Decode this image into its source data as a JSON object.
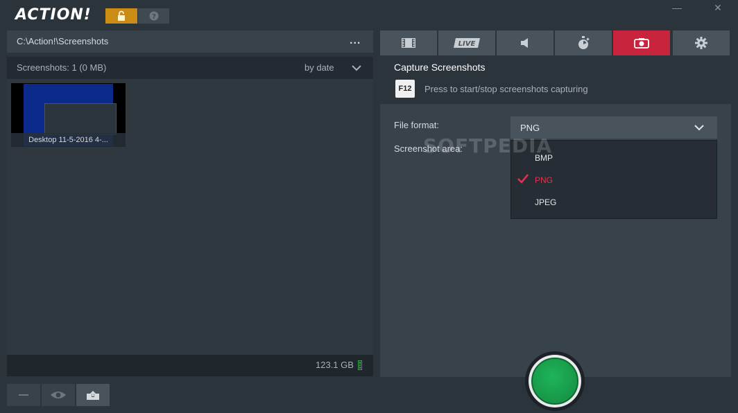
{
  "app": {
    "logo_text": "ACTION!",
    "window_controls": {
      "minimize": "—",
      "close": "✕"
    }
  },
  "header": {
    "lock_icon": "lock-icon",
    "help_icon": "question-icon"
  },
  "left_panel": {
    "path": "C:\\Action!\\Screenshots",
    "more_label": "...",
    "count_label": "Screenshots: 1 (0 MB)",
    "sort_label": "by date",
    "items": [
      {
        "caption": "Desktop 11-5-2016 4-..."
      }
    ],
    "disk_free": "123.1 GB"
  },
  "bottom_buttons": [
    {
      "icon": "minus-icon"
    },
    {
      "icon": "eye-icon"
    },
    {
      "icon": "export-icon"
    }
  ],
  "tabs": [
    {
      "icon": "film-icon"
    },
    {
      "icon": "live-icon",
      "label": "LIVE"
    },
    {
      "icon": "speaker-icon"
    },
    {
      "icon": "stopwatch-icon"
    },
    {
      "icon": "camera-icon",
      "active": true
    },
    {
      "icon": "gear-icon"
    }
  ],
  "capture": {
    "title": "Capture Screenshots",
    "hotkey": "F12",
    "hint": "Press to start/stop screenshots capturing"
  },
  "settings": {
    "file_format_label": "File format:",
    "file_format_value": "PNG",
    "screenshot_area_label": "Screenshot area:",
    "format_options": [
      {
        "label": "BMP",
        "selected": false
      },
      {
        "label": "PNG",
        "selected": true
      },
      {
        "label": "JPEG",
        "selected": false
      }
    ]
  },
  "watermark": "SOFTPEDIA",
  "colors": {
    "accent_red": "#c8243e",
    "lock_gold": "#c98d16",
    "record_green": "#1ba350"
  }
}
